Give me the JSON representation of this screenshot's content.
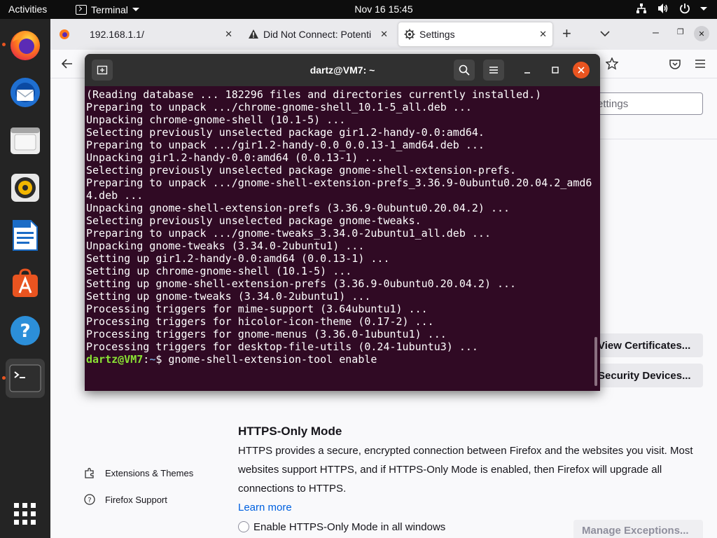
{
  "topbar": {
    "activities": "Activities",
    "app_name": "Terminal",
    "clock": "Nov 16  15:45"
  },
  "dock": {
    "items": [
      {
        "name": "firefox",
        "running": true
      },
      {
        "name": "thunderbird",
        "running": false
      },
      {
        "name": "files",
        "running": false
      },
      {
        "name": "rhythmbox",
        "running": false
      },
      {
        "name": "libreoffice-writer",
        "running": false
      },
      {
        "name": "ubuntu-software",
        "running": false
      },
      {
        "name": "help",
        "running": false
      },
      {
        "name": "terminal",
        "running": true
      }
    ]
  },
  "firefox": {
    "tabs": [
      {
        "label": "192.168.1.1/"
      },
      {
        "label": "Did Not Connect: Potenti"
      },
      {
        "label": "Settings"
      }
    ],
    "search_placeholder": "ettings",
    "view_certificates": "View Certificates...",
    "security_devices": "Security Devices...",
    "https_heading": "HTTPS-Only Mode",
    "https_desc_1": "HTTPS provides a secure, encrypted connection between Firefox and the websites you visit. Most",
    "https_desc_2": "websites support HTTPS, and if HTTPS-Only Mode is enabled, then Firefox will upgrade all",
    "https_desc_3": "connections to HTTPS.",
    "learn_more": "Learn more",
    "enable_all_windows": "Enable HTTPS-Only Mode in all windows",
    "manage_exceptions": "Manage Exceptions...",
    "extensions_themes": "Extensions & Themes",
    "firefox_support": "Firefox Support"
  },
  "terminal": {
    "title": "dartz@VM7: ~",
    "lines": [
      "(Reading database ... 182296 files and directories currently installed.)",
      "Preparing to unpack .../chrome-gnome-shell_10.1-5_all.deb ...",
      "Unpacking chrome-gnome-shell (10.1-5) ...",
      "Selecting previously unselected package gir1.2-handy-0.0:amd64.",
      "Preparing to unpack .../gir1.2-handy-0.0_0.0.13-1_amd64.deb ...",
      "Unpacking gir1.2-handy-0.0:amd64 (0.0.13-1) ...",
      "Selecting previously unselected package gnome-shell-extension-prefs.",
      "Preparing to unpack .../gnome-shell-extension-prefs_3.36.9-0ubuntu0.20.04.2_amd6",
      "4.deb ...",
      "Unpacking gnome-shell-extension-prefs (3.36.9-0ubuntu0.20.04.2) ...",
      "Selecting previously unselected package gnome-tweaks.",
      "Preparing to unpack .../gnome-tweaks_3.34.0-2ubuntu1_all.deb ...",
      "Unpacking gnome-tweaks (3.34.0-2ubuntu1) ...",
      "Setting up gir1.2-handy-0.0:amd64 (0.0.13-1) ...",
      "Setting up chrome-gnome-shell (10.1-5) ...",
      "Setting up gnome-shell-extension-prefs (3.36.9-0ubuntu0.20.04.2) ...",
      "Setting up gnome-tweaks (3.34.0-2ubuntu1) ...",
      "Processing triggers for mime-support (3.64ubuntu1) ...",
      "Processing triggers for hicolor-icon-theme (0.17-2) ...",
      "Processing triggers for gnome-menus (3.36.0-1ubuntu1) ...",
      "Processing triggers for desktop-file-utils (0.24-1ubuntu3) ..."
    ],
    "prompt_user": "dartz@VM7",
    "prompt_sep": ":",
    "prompt_path": "~",
    "prompt_sym": "$ ",
    "command": "gnome-shell-extension-tool enable"
  },
  "colors": {
    "terminal_bg": "#300a24",
    "prompt_user": "#8ae234",
    "prompt_path": "#729fcf",
    "ubuntu_orange": "#e95420"
  }
}
